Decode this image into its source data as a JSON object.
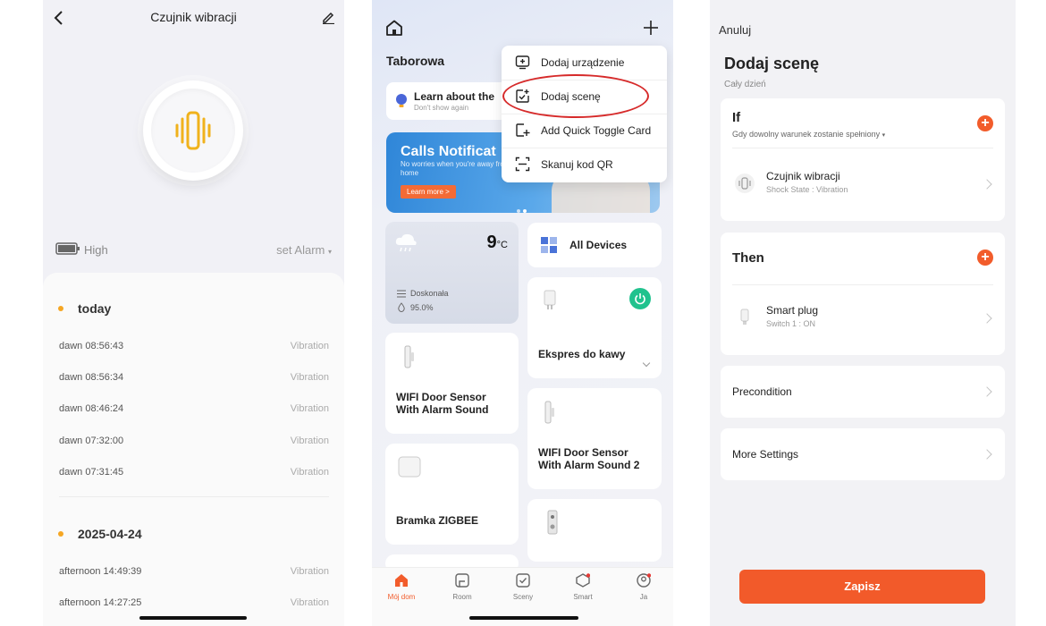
{
  "screen1": {
    "title": "Czujnik wibracji",
    "battery_level": "High",
    "set_alarm": "set Alarm",
    "groups": [
      {
        "day": "today",
        "events": [
          {
            "time": "dawn  08:56:43",
            "type": "Vibration"
          },
          {
            "time": "dawn  08:56:34",
            "type": "Vibration"
          },
          {
            "time": "dawn  08:46:24",
            "type": "Vibration"
          },
          {
            "time": "dawn  07:32:00",
            "type": "Vibration"
          },
          {
            "time": "dawn  07:31:45",
            "type": "Vibration"
          }
        ]
      },
      {
        "day": "2025-04-24",
        "events": [
          {
            "time": "afternoon  14:49:39",
            "type": "Vibration"
          },
          {
            "time": "afternoon  14:27:25",
            "type": "Vibration"
          }
        ]
      }
    ],
    "colors": {
      "accent": "#f5a623",
      "icon": "#f0b21c"
    }
  },
  "screen2": {
    "home_name": "Taborowa",
    "learn_title": "Learn about the",
    "learn_sub": "Don't show again",
    "banner_title": "Calls Notificat",
    "banner_text": "No worries when you're away from home",
    "banner_button": "Learn more >",
    "weather_temp": "9",
    "weather_unit": "°C",
    "weather_air": "Doskonała",
    "weather_humidity": "95.0%",
    "all_devices": "All Devices",
    "devices": {
      "d1": "Ekspres do kawy",
      "d2": "WIFI Door Sensor With Alarm Sound",
      "d3": "WIFI Door Sensor With Alarm Sound 2",
      "d4": "Bramka ZIGBEE"
    },
    "menu": [
      "Dodaj urządzenie",
      "Dodaj scenę",
      "Add Quick Toggle Card",
      "Skanuj kod QR"
    ],
    "tabs": [
      "Mój dom",
      "Room",
      "Sceny",
      "Smart",
      "Ja"
    ],
    "colors": {
      "active": "#f25c2b",
      "highlight": "#d62a2a",
      "power": "#21c28e"
    }
  },
  "screen3": {
    "cancel": "Anuluj",
    "title": "Dodaj scenę",
    "subtitle": "Cały dzień",
    "if_title": "If",
    "if_condition": "Gdy dowolny warunek zostanie spełniony",
    "if_device": "Czujnik wibracji",
    "if_state": "Shock State : Vibration",
    "then_title": "Then",
    "then_device": "Smart plug",
    "then_state": "Switch 1 : ON",
    "precondition": "Precondition",
    "more_settings": "More Settings",
    "save": "Zapisz",
    "colors": {
      "accent": "#f25c2b"
    }
  }
}
